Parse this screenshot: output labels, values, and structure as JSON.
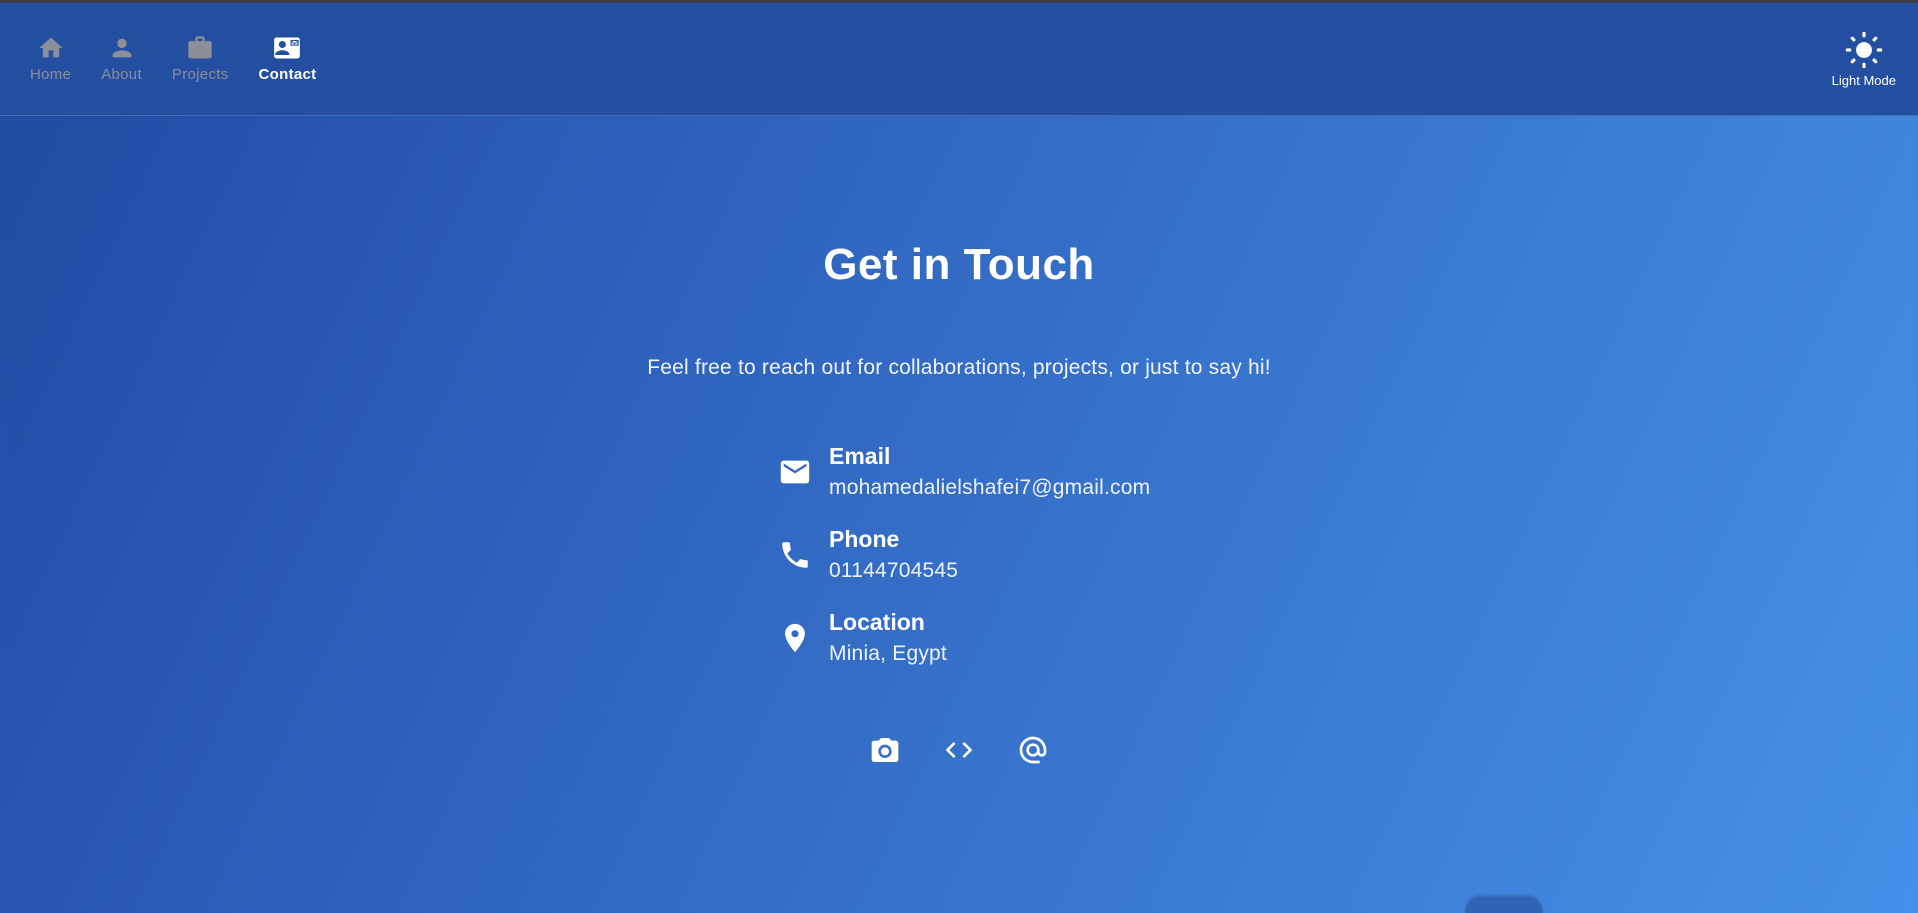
{
  "nav": {
    "items": [
      {
        "label": "Home",
        "icon": "home-icon",
        "active": false
      },
      {
        "label": "About",
        "icon": "person-icon",
        "active": false
      },
      {
        "label": "Projects",
        "icon": "briefcase-icon",
        "active": false
      },
      {
        "label": "Contact",
        "icon": "contact-card-icon",
        "active": true
      }
    ]
  },
  "theme_toggle": {
    "label": "Light Mode",
    "icon": "sun-icon"
  },
  "contact": {
    "heading": "Get in Touch",
    "subtitle": "Feel free to reach out for collaborations, projects, or just to say hi!",
    "items": [
      {
        "title": "Email",
        "value": "mohamedalielshafei7@gmail.com",
        "icon": "email-icon"
      },
      {
        "title": "Phone",
        "value": "01144704545",
        "icon": "phone-icon"
      },
      {
        "title": "Location",
        "value": "Minia, Egypt",
        "icon": "location-icon"
      }
    ],
    "social": [
      {
        "icon": "camera-icon"
      },
      {
        "icon": "code-icon"
      },
      {
        "icon": "at-sign-icon"
      }
    ]
  },
  "colors": {
    "navbar_bg": "#244ea0",
    "gradient_start": "#1f4aa0",
    "gradient_end": "#4590e8",
    "inactive_nav": "#8a8f9a",
    "text": "#ffffff"
  }
}
